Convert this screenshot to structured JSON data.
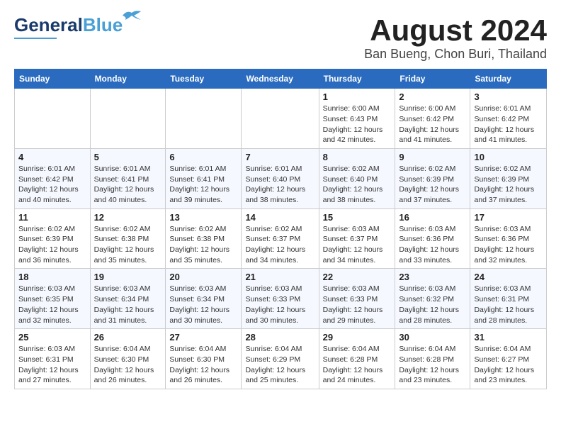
{
  "header": {
    "logo_general": "General",
    "logo_blue": "Blue",
    "month_title": "August 2024",
    "location": "Ban Bueng, Chon Buri, Thailand"
  },
  "weekdays": [
    "Sunday",
    "Monday",
    "Tuesday",
    "Wednesday",
    "Thursday",
    "Friday",
    "Saturday"
  ],
  "weeks": [
    [
      {
        "day": "",
        "info": ""
      },
      {
        "day": "",
        "info": ""
      },
      {
        "day": "",
        "info": ""
      },
      {
        "day": "",
        "info": ""
      },
      {
        "day": "1",
        "info": "Sunrise: 6:00 AM\nSunset: 6:43 PM\nDaylight: 12 hours\nand 42 minutes."
      },
      {
        "day": "2",
        "info": "Sunrise: 6:00 AM\nSunset: 6:42 PM\nDaylight: 12 hours\nand 41 minutes."
      },
      {
        "day": "3",
        "info": "Sunrise: 6:01 AM\nSunset: 6:42 PM\nDaylight: 12 hours\nand 41 minutes."
      }
    ],
    [
      {
        "day": "4",
        "info": "Sunrise: 6:01 AM\nSunset: 6:42 PM\nDaylight: 12 hours\nand 40 minutes."
      },
      {
        "day": "5",
        "info": "Sunrise: 6:01 AM\nSunset: 6:41 PM\nDaylight: 12 hours\nand 40 minutes."
      },
      {
        "day": "6",
        "info": "Sunrise: 6:01 AM\nSunset: 6:41 PM\nDaylight: 12 hours\nand 39 minutes."
      },
      {
        "day": "7",
        "info": "Sunrise: 6:01 AM\nSunset: 6:40 PM\nDaylight: 12 hours\nand 38 minutes."
      },
      {
        "day": "8",
        "info": "Sunrise: 6:02 AM\nSunset: 6:40 PM\nDaylight: 12 hours\nand 38 minutes."
      },
      {
        "day": "9",
        "info": "Sunrise: 6:02 AM\nSunset: 6:39 PM\nDaylight: 12 hours\nand 37 minutes."
      },
      {
        "day": "10",
        "info": "Sunrise: 6:02 AM\nSunset: 6:39 PM\nDaylight: 12 hours\nand 37 minutes."
      }
    ],
    [
      {
        "day": "11",
        "info": "Sunrise: 6:02 AM\nSunset: 6:39 PM\nDaylight: 12 hours\nand 36 minutes."
      },
      {
        "day": "12",
        "info": "Sunrise: 6:02 AM\nSunset: 6:38 PM\nDaylight: 12 hours\nand 35 minutes."
      },
      {
        "day": "13",
        "info": "Sunrise: 6:02 AM\nSunset: 6:38 PM\nDaylight: 12 hours\nand 35 minutes."
      },
      {
        "day": "14",
        "info": "Sunrise: 6:02 AM\nSunset: 6:37 PM\nDaylight: 12 hours\nand 34 minutes."
      },
      {
        "day": "15",
        "info": "Sunrise: 6:03 AM\nSunset: 6:37 PM\nDaylight: 12 hours\nand 34 minutes."
      },
      {
        "day": "16",
        "info": "Sunrise: 6:03 AM\nSunset: 6:36 PM\nDaylight: 12 hours\nand 33 minutes."
      },
      {
        "day": "17",
        "info": "Sunrise: 6:03 AM\nSunset: 6:36 PM\nDaylight: 12 hours\nand 32 minutes."
      }
    ],
    [
      {
        "day": "18",
        "info": "Sunrise: 6:03 AM\nSunset: 6:35 PM\nDaylight: 12 hours\nand 32 minutes."
      },
      {
        "day": "19",
        "info": "Sunrise: 6:03 AM\nSunset: 6:34 PM\nDaylight: 12 hours\nand 31 minutes."
      },
      {
        "day": "20",
        "info": "Sunrise: 6:03 AM\nSunset: 6:34 PM\nDaylight: 12 hours\nand 30 minutes."
      },
      {
        "day": "21",
        "info": "Sunrise: 6:03 AM\nSunset: 6:33 PM\nDaylight: 12 hours\nand 30 minutes."
      },
      {
        "day": "22",
        "info": "Sunrise: 6:03 AM\nSunset: 6:33 PM\nDaylight: 12 hours\nand 29 minutes."
      },
      {
        "day": "23",
        "info": "Sunrise: 6:03 AM\nSunset: 6:32 PM\nDaylight: 12 hours\nand 28 minutes."
      },
      {
        "day": "24",
        "info": "Sunrise: 6:03 AM\nSunset: 6:31 PM\nDaylight: 12 hours\nand 28 minutes."
      }
    ],
    [
      {
        "day": "25",
        "info": "Sunrise: 6:03 AM\nSunset: 6:31 PM\nDaylight: 12 hours\nand 27 minutes."
      },
      {
        "day": "26",
        "info": "Sunrise: 6:04 AM\nSunset: 6:30 PM\nDaylight: 12 hours\nand 26 minutes."
      },
      {
        "day": "27",
        "info": "Sunrise: 6:04 AM\nSunset: 6:30 PM\nDaylight: 12 hours\nand 26 minutes."
      },
      {
        "day": "28",
        "info": "Sunrise: 6:04 AM\nSunset: 6:29 PM\nDaylight: 12 hours\nand 25 minutes."
      },
      {
        "day": "29",
        "info": "Sunrise: 6:04 AM\nSunset: 6:28 PM\nDaylight: 12 hours\nand 24 minutes."
      },
      {
        "day": "30",
        "info": "Sunrise: 6:04 AM\nSunset: 6:28 PM\nDaylight: 12 hours\nand 23 minutes."
      },
      {
        "day": "31",
        "info": "Sunrise: 6:04 AM\nSunset: 6:27 PM\nDaylight: 12 hours\nand 23 minutes."
      }
    ]
  ]
}
